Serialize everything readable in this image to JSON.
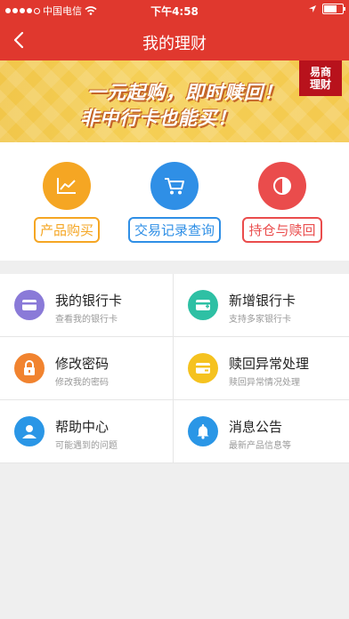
{
  "status": {
    "carrier": "中国电信",
    "time": "下午4:58"
  },
  "nav": {
    "title": "我的理财"
  },
  "banner": {
    "line1": "一元起购，即时赎回！",
    "line2": "非中行卡也能买！",
    "logo_text": "易商理财"
  },
  "quick": [
    {
      "label": "产品购买",
      "color": "#f5a623"
    },
    {
      "label": "交易记录查询",
      "color": "#2f8fe6"
    },
    {
      "label": "持仓与赎回",
      "color": "#ea4c4c"
    }
  ],
  "menu": [
    {
      "title": "我的银行卡",
      "sub": "查看我的银行卡",
      "color": "#8a7ad8"
    },
    {
      "title": "新增银行卡",
      "sub": "支持多家银行卡",
      "color": "#2ec0a4"
    },
    {
      "title": "修改密码",
      "sub": "修改我的密码",
      "color": "#f1832f"
    },
    {
      "title": "赎回异常处理",
      "sub": "赎回异常情况处理",
      "color": "#f5c21f"
    },
    {
      "title": "帮助中心",
      "sub": "可能遇到的问题",
      "color": "#2a96e6"
    },
    {
      "title": "消息公告",
      "sub": "最新产品信息等",
      "color": "#2a96e6"
    }
  ]
}
